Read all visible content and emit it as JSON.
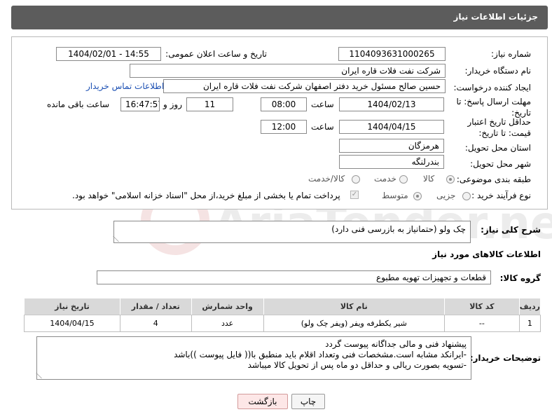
{
  "header": {
    "title": "جزئیات اطلاعات نیاز"
  },
  "form": {
    "need_number": {
      "label": "شماره نیاز:",
      "value": "1104093631000265"
    },
    "announce_datetime": {
      "label": "تاریخ و ساعت اعلان عمومی:",
      "value": "1404/02/01 - 14:55"
    },
    "buyer_org": {
      "label": "نام دستگاه خریدار:",
      "value": "شرکت نفت فلات قاره ایران"
    },
    "requester": {
      "label": "ایجاد کننده درخواست:",
      "value": "حسین  صالح مسئول خرید دفتر اصفهان شرکت نفت فلات قاره ایران",
      "contact_link": "اطلاعات تماس خریدار"
    },
    "reply_deadline": {
      "label": "مهلت ارسال پاسخ: تا تاریخ:",
      "date": "1404/02/13",
      "time_label": "ساعت",
      "time": "08:00",
      "days": "11",
      "days_label": "روز و",
      "remaining": "16:47:57",
      "remaining_label": "ساعت باقی مانده"
    },
    "price_validity": {
      "label": "حداقل تاریخ اعتبار قیمت: تا تاریخ:",
      "date": "1404/04/15",
      "time_label": "ساعت",
      "time": "12:00"
    },
    "delivery_province": {
      "label": "استان محل تحویل:",
      "value": "هرمزگان"
    },
    "delivery_city": {
      "label": "شهر محل تحویل:",
      "value": "بندرلنگه"
    },
    "category": {
      "label": "طبقه بندی موضوعی:",
      "options": [
        "کالا",
        "خدمت",
        "کالا/خدمت"
      ],
      "selected": "کالا"
    },
    "process_type": {
      "label": "نوع فرآیند خرید :",
      "options": [
        "جزیی",
        "متوسط"
      ],
      "selected": "متوسط",
      "payment_note": "پرداخت تمام یا بخشی از مبلغ خرید،از محل \"اسناد خزانه اسلامی\" خواهد بود."
    }
  },
  "summary": {
    "label": "شرح کلی نیاز:",
    "value": "چک ولو (حتمانیاز به بازرسی فنی دارد)"
  },
  "items_section": {
    "title": "اطلاعات کالاهای مورد نیاز"
  },
  "goods_group": {
    "label": "گروه کالا:",
    "value": "قطعات و تجهیزات تهویه مطبوع"
  },
  "table": {
    "headers": [
      "ردیف",
      "کد کالا",
      "نام کالا",
      "واحد شمارش",
      "تعداد / مقدار",
      "تاریخ نیاز"
    ],
    "rows": [
      [
        "1",
        "--",
        "شیر یکطرفه ویفر (ویفر چک ولو)",
        "عدد",
        "4",
        "1404/04/15"
      ]
    ]
  },
  "buyer_notes": {
    "label": "توضیحات خریدار:",
    "lines": [
      "پیشنهاد فنی و مالی جداگانه پیوست گردد",
      "-ایرانکد مشابه است.مشخصات فنی وتعداد اقلام باید منطبق با(( فایل پیوست ))باشد",
      "-تسویه بصورت ریالی و حداقل دو ماه پس از تحویل کالا میباشد"
    ]
  },
  "buttons": {
    "print": "چاپ",
    "back": "بازگشت"
  },
  "watermark": {
    "text": "AriaTender.net"
  },
  "colors": {
    "header_bg": "#5c5c5c",
    "link": "#1b4fb3",
    "table_header": "#d9d9d9"
  }
}
